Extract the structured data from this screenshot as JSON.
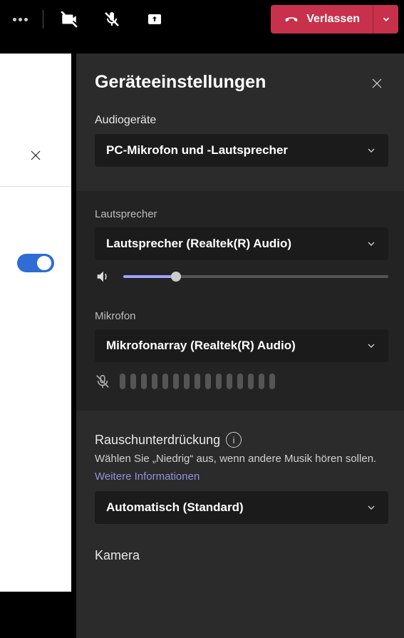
{
  "topbar": {
    "leave_label": "Verlassen"
  },
  "left": {
    "toggle_on": true
  },
  "pane": {
    "title": "Geräteeinstellungen",
    "audio_devices": {
      "label": "Audiogeräte",
      "value": "PC-Mikrofon und -Lautsprecher"
    },
    "speaker": {
      "label": "Lautsprecher",
      "value": "Lautsprecher (Realtek(R) Audio)",
      "volume_percent": 20
    },
    "mic": {
      "label": "Mikrofon",
      "value": "Mikrofonarray (Realtek(R) Audio)"
    },
    "noise": {
      "label": "Rauschunterdrückung",
      "desc": "Wählen Sie „Niedrig“ aus, wenn andere Musik hören sollen.",
      "link": "Weitere Informationen",
      "value": "Automatisch (Standard)"
    },
    "camera": {
      "label": "Kamera"
    }
  }
}
